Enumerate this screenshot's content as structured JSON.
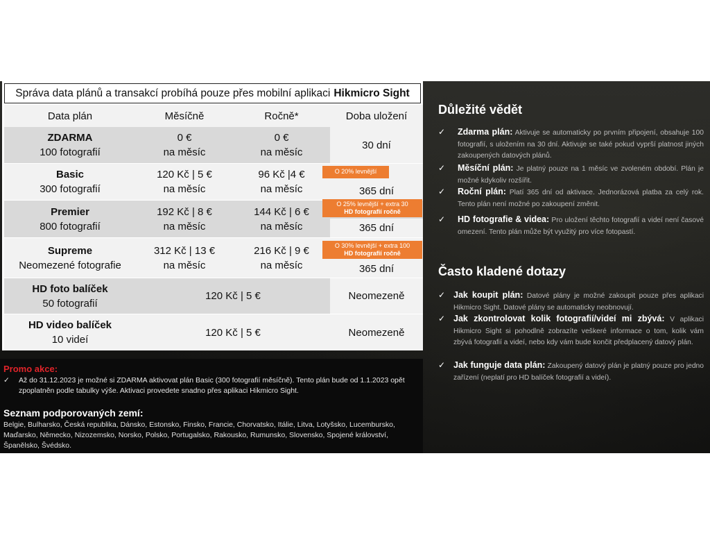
{
  "header": {
    "text": "Správa data plánů a transakcí probíhá pouze přes mobilní aplikaci",
    "app": "Hikmicro Sight"
  },
  "columns": [
    "Data plán",
    "Měsíčně",
    "Ročně*",
    "Doba uložení"
  ],
  "rows": [
    {
      "plan": "ZDARMA",
      "detail": "100 fotografií",
      "monthly": "0 €",
      "monthly_sub": "na měsíc",
      "yearly": "0 €",
      "yearly_sub": "na měsíc",
      "storage": "30 dní",
      "badge": ""
    },
    {
      "plan": "Basic",
      "detail": "300 fotografií",
      "monthly": "120 Kč | 5 €",
      "monthly_sub": "na měsíc",
      "yearly": "96 Kč |4 €",
      "yearly_sub": "na měsíc",
      "storage": "365 dní",
      "badge": "O 20% levnější"
    },
    {
      "plan": "Premier",
      "detail": "800 fotografií",
      "monthly": "192 Kč | 8 €",
      "monthly_sub": "na měsíc",
      "yearly": "144 Kč | 6 €",
      "yearly_sub": "na měsíc",
      "storage": "365 dní",
      "badge": "O 25% levnější + extra 30",
      "badge_bold": "HD fotografií ročně"
    },
    {
      "plan": "Supreme",
      "detail": "Neomezené fotografie",
      "monthly": "312 Kč | 13 €",
      "monthly_sub": "na měsíc",
      "yearly": "216 Kč | 9 €",
      "yearly_sub": "na měsíc",
      "storage": "365 dní",
      "badge": "O 30% levnější + extra 100",
      "badge_bold": "HD fotografií ročně"
    },
    {
      "plan": "HD foto balíček",
      "detail": "50 fotografií",
      "price": "120 Kč | 5 €",
      "storage": "Neomezeně"
    },
    {
      "plan": "HD video balíček",
      "detail": "10 videí",
      "price": "120 Kč | 5 €",
      "storage": "Neomezeně"
    }
  ],
  "promo": {
    "title": "Promo akce:",
    "check": "✓",
    "text": "Až do 31.12.2023 je možné si ZDARMA aktivovat plán Basic (300 fotografií měsíčně). Tento plán bude od 1.1.2023 opět zpoplatněn podle tabulky výše. Aktivaci provedete snadno přes aplikaci Hikmicro Sight."
  },
  "countries": {
    "title": "Seznam podporovaných zemí:",
    "text": "Belgie, Bulharsko, Česká republika, Dánsko, Estonsko, Finsko, Francie, Chorvatsko, Itálie, Litva, Lotyšsko, Lucembursko, Maďarsko, Německo, Nizozemsko, Norsko, Polsko, Portugalsko, Rakousko, Rumunsko, Slovensko, Spojené království, Španělsko, Švédsko."
  },
  "important": {
    "title": "Důležité vědět",
    "items": [
      {
        "label": "Zdarma plán:",
        "text": "Aktivuje se automaticky po prvním připojení, obsahuje 100 fotografií, s uložením na 30 dní. Aktivuje se také pokud vyprší platnost jiných zakoupených datových plánů."
      },
      {
        "label": "Měsíční plán:",
        "text": "Je platný pouze na 1 měsíc ve zvoleném období. Plán je možné kdykoliv rozšířit."
      },
      {
        "label": "Roční plán:",
        "text": "Platí 365 dní od aktivace. Jednorázová platba za celý rok. Tento plán není možné po zakoupení změnit."
      },
      {
        "label": "HD fotografie & videa:",
        "text": "Pro uložení těchto fotografií a videí není časové omezení. Tento plán může být využitý pro více fotopastí."
      }
    ]
  },
  "faq": {
    "title": "Často kladené dotazy",
    "items": [
      {
        "label": "Jak koupit plán:",
        "text": "Datové plány je možné zakoupit pouze přes aplikaci Hikmicro Sight. Datové plány se automaticky neobnovují."
      },
      {
        "label": "Jak zkontrolovat kolik fotografií/videí mi zbývá:",
        "text": "V aplikaci Hikmicro Sight si pohodlně zobrazíte veškeré informace o tom, kolik vám zbývá fotografií a videí, nebo kdy vám bude končit předplacený datový plán."
      },
      {
        "label": "Jak funguje data plán:",
        "text": "Zakoupený datový plán je platný pouze pro jedno zařízení (neplatí pro HD balíček fotografií a videí)."
      }
    ]
  },
  "colors": {
    "accent": "#ed7d31",
    "promo": "#e0242a",
    "row_alt": "#d9d9d9",
    "row_light": "#f2f2f2"
  }
}
